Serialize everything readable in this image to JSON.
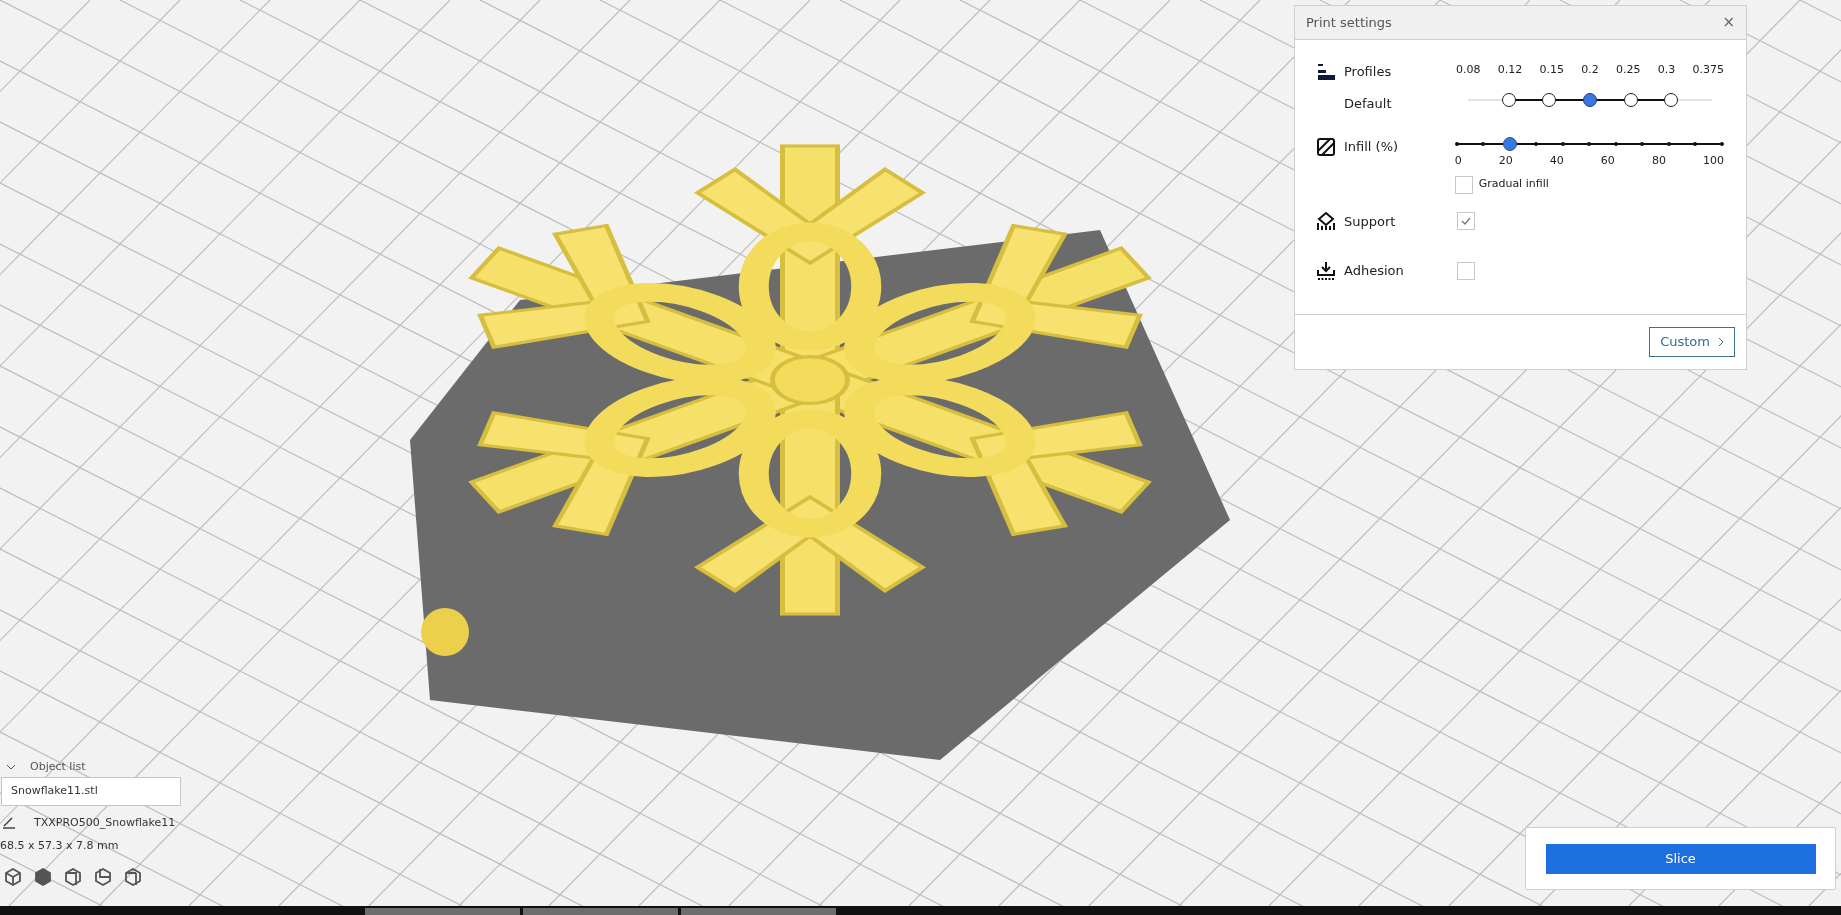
{
  "print_settings": {
    "title": "Print settings",
    "close": "×",
    "profiles": {
      "label": "Profiles",
      "profile": "Default",
      "layers": [
        {
          "label": "0.08",
          "available": false,
          "selected": false
        },
        {
          "label": "0.12",
          "available": true,
          "selected": false
        },
        {
          "label": "0.15",
          "available": true,
          "selected": false
        },
        {
          "label": "0.2",
          "available": true,
          "selected": true
        },
        {
          "label": "0.25",
          "available": true,
          "selected": false
        },
        {
          "label": "0.3",
          "available": true,
          "selected": false
        },
        {
          "label": "0.375",
          "available": false,
          "selected": false
        }
      ]
    },
    "infill": {
      "label": "Infill (%)",
      "level": 0.2,
      "ticks": [
        "0",
        "20",
        "40",
        "60",
        "80",
        "100"
      ],
      "gradual": {
        "label": "Gradual infill",
        "checked": false
      }
    },
    "support": {
      "label": "Support",
      "checked": true
    },
    "adhesion": {
      "label": "Adhesion",
      "checked": false
    },
    "custom_button": "Custom"
  },
  "object_list": {
    "title": "Object list",
    "expanded": true,
    "file": "Snowflake11.stl",
    "name": "TXXPRO500_Snowflake11",
    "dimensions": "68.5 x 57.3 x 7.8 mm"
  },
  "slice_button": "Slice"
}
